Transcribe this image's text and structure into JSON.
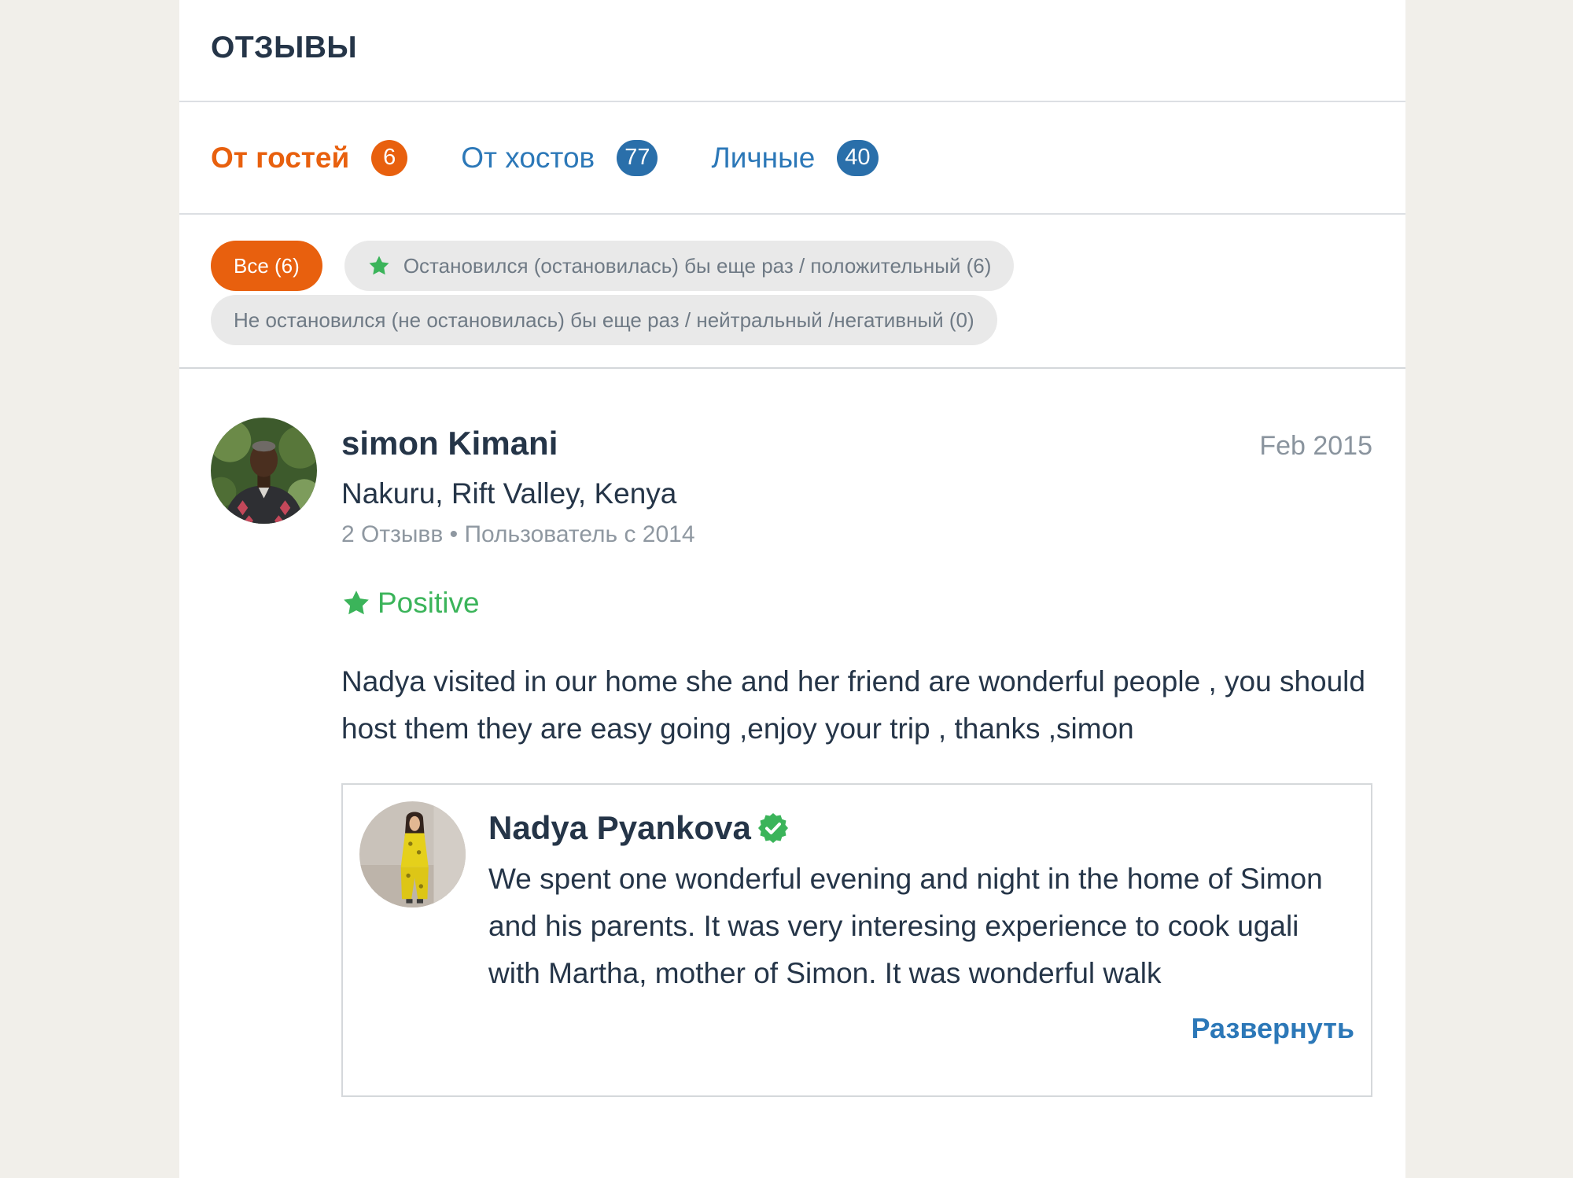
{
  "header": {
    "title": "ОТЗЫВЫ"
  },
  "tabs": [
    {
      "label": "От гостей",
      "count": "6",
      "active": true
    },
    {
      "label": "От хостов",
      "count": "77",
      "active": false
    },
    {
      "label": "Личные",
      "count": "40",
      "active": false
    }
  ],
  "filters": [
    {
      "label": "Все (6)",
      "active": true
    },
    {
      "label": "Остановился (остановилась) бы еще раз / положительный (6)",
      "icon": "star-icon",
      "active": false
    },
    {
      "label": "Не остановился (не остановилась) бы еще раз / нейтральный /негативный (0)",
      "active": false
    }
  ],
  "review": {
    "author": "simon Kimani",
    "date": "Feb 2015",
    "location": "Nakuru, Rift Valley, Kenya",
    "meta": "2 Отзывв • Пользователь с 2014",
    "rating": "Positive",
    "rating_icon": "star-icon",
    "text": "Nadya visited in our home she and her friend are wonderful people , you should host them they are easy going ,enjoy your trip , thanks ,simon",
    "reply": {
      "author": "Nadya Pyankova",
      "verified_icon": "verified-badge-icon",
      "text": "We spent one wonderful evening and night in the home of Simon and his parents. It was very interesing experience to cook ugali with Martha, mother of Simon. It was wonderful walk",
      "expand_label": "Развернуть"
    }
  },
  "colors": {
    "accent": "#e8600e",
    "blue": "#2c78b8",
    "green": "#3bb45a",
    "text": "#253548",
    "muted": "#8a949e"
  }
}
